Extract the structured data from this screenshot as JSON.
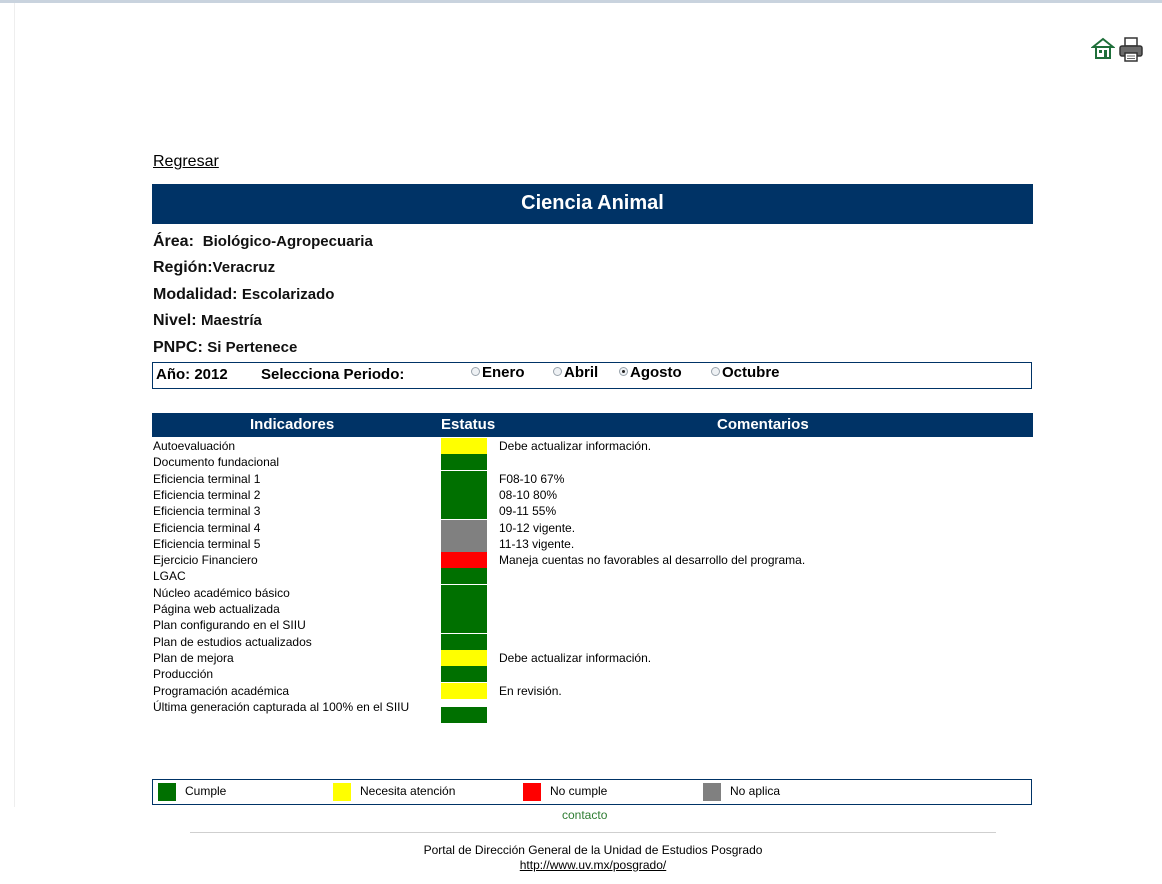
{
  "header": {
    "home_icon": "home-icon",
    "print_icon": "printer-icon"
  },
  "nav": {
    "back_label": "Regresar"
  },
  "program": {
    "title": "Ciencia Animal",
    "area_label": "Área:",
    "area_value": "Biológico-Agropecuaria",
    "region_label": "Región:",
    "region_value": "Veracruz",
    "modalidad_label": "Modalidad:",
    "modalidad_value": "Escolarizado",
    "nivel_label": "Nivel:",
    "nivel_value": "Maestría",
    "pnpc_label": "PNPC:",
    "pnpc_value": "Si Pertenece"
  },
  "period": {
    "year_text": "Año: 2012",
    "select_label": "Selecciona Periodo:",
    "options": [
      {
        "label": "Enero",
        "selected": false
      },
      {
        "label": "Abril",
        "selected": false
      },
      {
        "label": "Agosto",
        "selected": true
      },
      {
        "label": "Octubre",
        "selected": false
      }
    ]
  },
  "table": {
    "headers": [
      "Indicadores",
      "Estatus",
      "Comentarios"
    ],
    "rows": [
      {
        "indicator": "Autoevaluación",
        "status": "yellow",
        "comment": "Debe actualizar información."
      },
      {
        "indicator": "Documento fundacional",
        "status": "green",
        "comment": ""
      },
      {
        "indicator": "Eficiencia terminal 1",
        "status": "green",
        "comment": "F08-10 67%"
      },
      {
        "indicator": "Eficiencia terminal 2",
        "status": "green",
        "comment": "08-10 80%"
      },
      {
        "indicator": "Eficiencia terminal 3",
        "status": "green",
        "comment": "09-11 55%"
      },
      {
        "indicator": "Eficiencia terminal 4",
        "status": "gray",
        "comment": "10-12 vigente."
      },
      {
        "indicator": "Eficiencia terminal 5",
        "status": "gray",
        "comment": "11-13 vigente."
      },
      {
        "indicator": "Ejercicio Financiero",
        "status": "red",
        "comment": "Maneja cuentas no favorables al desarrollo del programa."
      },
      {
        "indicator": "LGAC",
        "status": "green",
        "comment": ""
      },
      {
        "indicator": "Núcleo académico básico",
        "status": "green",
        "comment": ""
      },
      {
        "indicator": "Página web actualizada",
        "status": "green",
        "comment": ""
      },
      {
        "indicator": "Plan configurando en el SIIU",
        "status": "green",
        "comment": ""
      },
      {
        "indicator": "Plan de estudios actualizados",
        "status": "green",
        "comment": ""
      },
      {
        "indicator": "Plan de mejora",
        "status": "yellow",
        "comment": "Debe actualizar información."
      },
      {
        "indicator": "Producción",
        "status": "green",
        "comment": ""
      },
      {
        "indicator": "Programación académica",
        "status": "yellow",
        "comment": "En revisión."
      },
      {
        "indicator": "Última generación capturada al 100% en el SIIU",
        "status": "green",
        "comment": ""
      }
    ]
  },
  "legend": [
    {
      "label": "Cumple",
      "color": "#007000"
    },
    {
      "label": "Necesita atención",
      "color": "#ffff00"
    },
    {
      "label": "No cumple",
      "color": "#ff0000"
    },
    {
      "label": "No aplica",
      "color": "#808080"
    }
  ],
  "status_colors": {
    "green": "#007000",
    "yellow": "#ffff00",
    "red": "#ff0000",
    "gray": "#808080"
  },
  "footer": {
    "contact_label": "contacto",
    "portal_text": "Portal de Dirección General de la Unidad de Estudios Posgrado",
    "portal_link": "http://www.uv.mx/posgrado/"
  }
}
